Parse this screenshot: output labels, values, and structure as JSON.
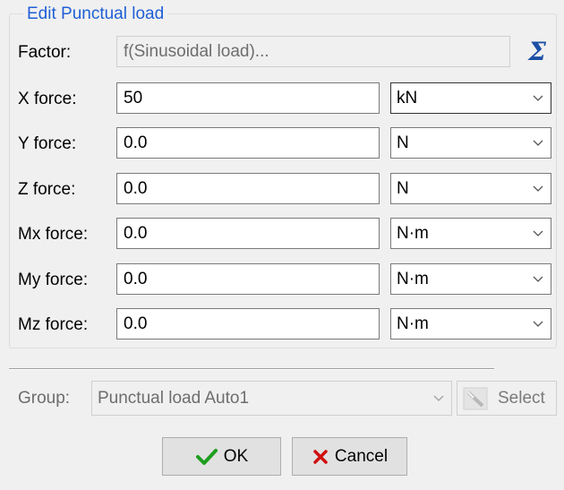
{
  "dialog": {
    "group_title": "Edit Punctual load"
  },
  "rows": [
    {
      "label": "Factor:",
      "value": "f(Sinusoidal load)..."
    },
    {
      "label": "X force:",
      "value": "50",
      "unit": "kN"
    },
    {
      "label": "Y force:",
      "value": "0.0",
      "unit": "N"
    },
    {
      "label": "Z force:",
      "value": "0.0",
      "unit": "N"
    },
    {
      "label": "Mx force:",
      "value": "0.0",
      "unit": "N·m"
    },
    {
      "label": "My force:",
      "value": "0.0",
      "unit": "N·m"
    },
    {
      "label": "Mz force:",
      "value": "0.0",
      "unit": "N·m"
    }
  ],
  "sigma_symbol": "Σ",
  "group": {
    "label": "Group:",
    "value": "Punctual load Auto1",
    "select_label": "Select"
  },
  "buttons": {
    "ok": "OK",
    "cancel": "Cancel"
  },
  "colors": {
    "title": "#1f5fd6",
    "ok_check": "#1e9e1e",
    "cancel_x": "#d01010",
    "sigma": "#1c4fa6"
  },
  "icons": [
    "sigma-icon",
    "chevron-down-icon",
    "select-pointer-icon",
    "checkmark-icon",
    "cross-icon"
  ]
}
